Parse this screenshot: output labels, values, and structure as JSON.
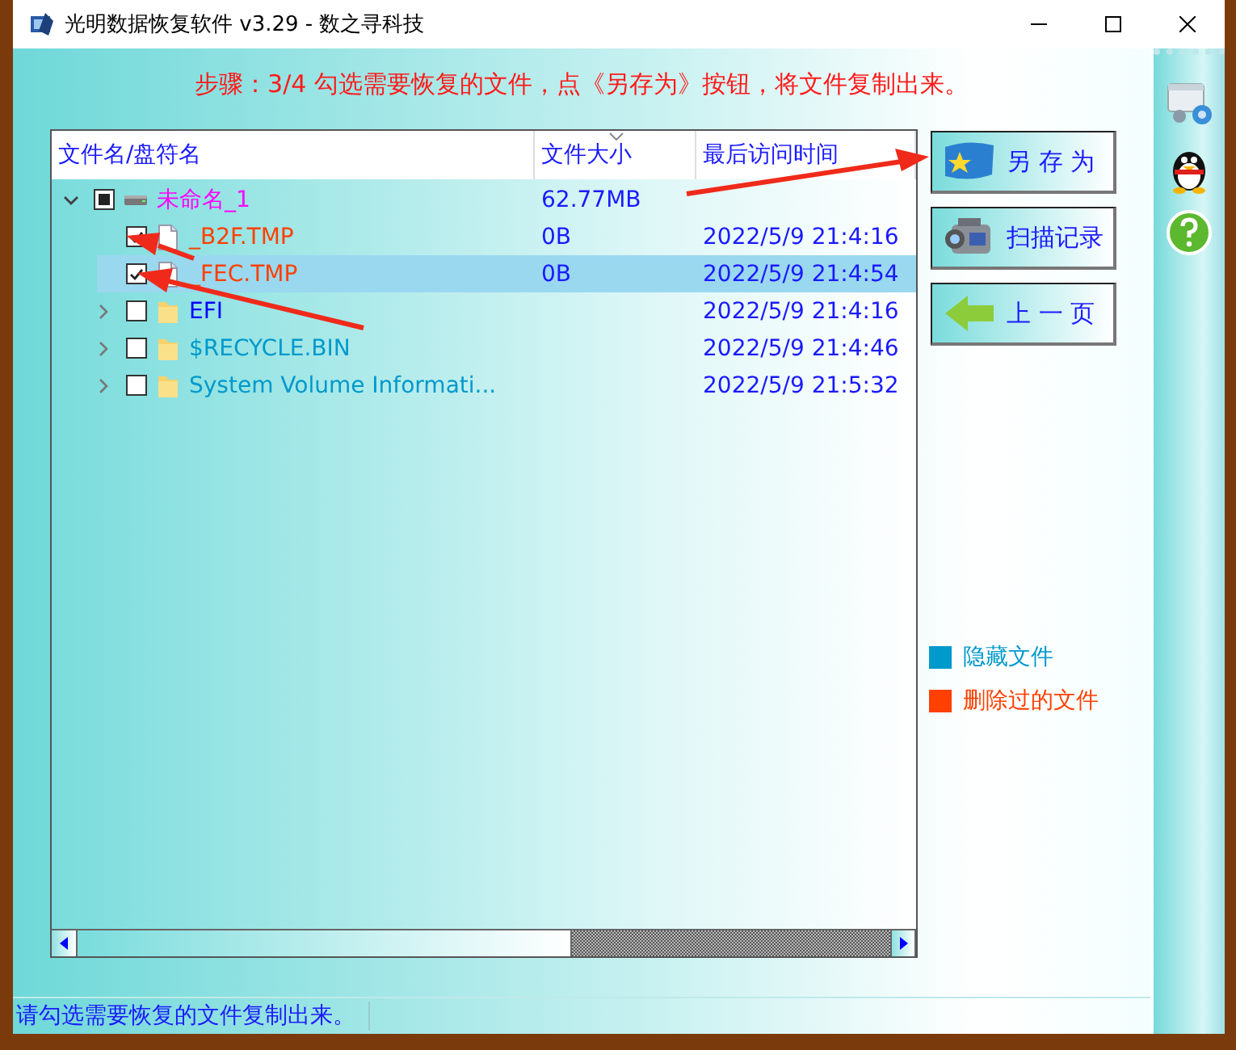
{
  "window": {
    "title": "光明数据恢复软件 v3.29 - 数之寻科技"
  },
  "step_banner": "步骤：3/4 勾选需要恢复的文件，点《另存为》按钮，将文件复制出来。",
  "file_list": {
    "columns": [
      "文件名/盘符名",
      "文件大小",
      "最后访问时间"
    ],
    "tree": [
      {
        "kind": "drive",
        "name": "未命名_1",
        "size": "62.77MB",
        "color": "#ff00ff",
        "checked": false,
        "partial": true,
        "expanded": true,
        "selected": false,
        "children": [
          {
            "kind": "file",
            "name": "_B2F.TMP",
            "size": "0B",
            "time": "2022/5/9 21:4:16",
            "color": "#ff4000",
            "checked": true,
            "partial": false,
            "selected": false
          },
          {
            "kind": "file",
            "name": "_FEC.TMP",
            "size": "0B",
            "time": "2022/5/9 21:4:54",
            "color": "#ff4000",
            "checked": true,
            "partial": false,
            "selected": true
          },
          {
            "kind": "folder",
            "name": "EFI",
            "time": "2022/5/9 21:4:16",
            "color": "#0000ff",
            "checked": false,
            "partial": false,
            "expanded": false,
            "selected": false
          },
          {
            "kind": "folder",
            "name": "$RECYCLE.BIN",
            "time": "2022/5/9 21:4:46",
            "color": "#0099cc",
            "checked": false,
            "partial": false,
            "expanded": false,
            "selected": false
          },
          {
            "kind": "folder",
            "name": "System Volume Informati...",
            "time": "2022/5/9 21:5:32",
            "color": "#0099cc",
            "checked": false,
            "partial": false,
            "expanded": false,
            "selected": false
          }
        ]
      }
    ]
  },
  "actions": [
    {
      "kind": "save",
      "label": "另 存 为"
    },
    {
      "kind": "log",
      "label": "扫描记录"
    },
    {
      "kind": "back",
      "label": "上 一 页"
    }
  ],
  "legend": [
    {
      "label": "隐藏文件",
      "color": "#0099cc"
    },
    {
      "label": "删除过的文件",
      "color": "#ff4000"
    }
  ],
  "status_bar": "请勾选需要恢复的文件复制出来。"
}
